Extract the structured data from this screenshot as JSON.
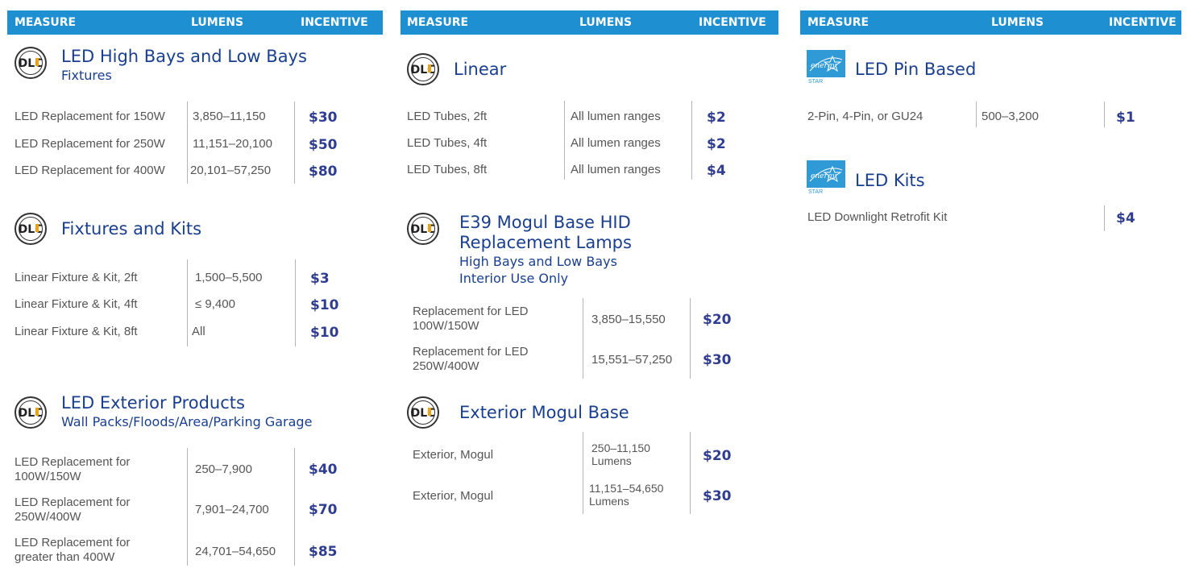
{
  "header": {
    "measure": "MEASURE",
    "lumens": "LUMENS",
    "incentive": "INCENTIVE"
  },
  "col1": {
    "s1": {
      "title": "LED High Bays and Low Bays",
      "subtitle": "Fixtures",
      "rows": [
        {
          "measure": "LED Replacement for 150W",
          "lumens": "3,850–11,150",
          "incentive": "$30"
        },
        {
          "measure": "LED Replacement for 250W",
          "lumens": "11,151–20,100",
          "incentive": "$50"
        },
        {
          "measure": "LED Replacement for 400W",
          "lumens": "20,101–57,250",
          "incentive": "$80"
        }
      ]
    },
    "s2": {
      "title": "Fixtures and Kits",
      "rows": [
        {
          "measure": "Linear Fixture & Kit, 2ft",
          "lumens": "1,500–5,500",
          "incentive": "$3"
        },
        {
          "measure": "Linear Fixture & Kit, 4ft",
          "lumens": "≤ 9,400",
          "incentive": "$10"
        },
        {
          "measure": "Linear Fixture & Kit, 8ft",
          "lumens": "All",
          "incentive": "$10"
        }
      ]
    },
    "s3": {
      "title": "LED Exterior Products",
      "subtitle": "Wall Packs/Floods/Area/Parking Garage",
      "rows": [
        {
          "measure_a": "LED Replacement for",
          "measure_b": "100W/150W",
          "lumens": "250–7,900",
          "incentive": "$40"
        },
        {
          "measure_a": "LED Replacement for",
          "measure_b": "250W/400W",
          "lumens": "7,901–24,700",
          "incentive": "$70"
        },
        {
          "measure_a": "LED Replacement for",
          "measure_b": "greater than 400W",
          "lumens": "24,701–54,650",
          "incentive": "$85"
        }
      ]
    }
  },
  "col2": {
    "s1": {
      "title": "Linear",
      "rows": [
        {
          "measure": "LED Tubes, 2ft",
          "lumens": "All lumen ranges",
          "incentive": "$2"
        },
        {
          "measure": "LED Tubes, 4ft",
          "lumens": "All lumen ranges",
          "incentive": "$2"
        },
        {
          "measure": "LED Tubes, 8ft",
          "lumens": "All lumen ranges",
          "incentive": "$4"
        }
      ]
    },
    "s2": {
      "title_a": "E39 Mogul Base HID",
      "title_b": "Replacement Lamps",
      "subtitle_a": "High Bays and Low Bays",
      "subtitle_b": "Interior Use Only",
      "rows": [
        {
          "measure_a": "Replacement for LED",
          "measure_b": "100W/150W",
          "lumens": "3,850–15,550",
          "incentive": "$20"
        },
        {
          "measure_a": "Replacement for LED",
          "measure_b": "250W/400W",
          "lumens": "15,551–57,250",
          "incentive": "$30"
        }
      ]
    },
    "s3": {
      "title": "Exterior Mogul Base",
      "rows": [
        {
          "measure": "Exterior, Mogul",
          "lumens_a": "250–11,150",
          "lumens_b": "Lumens",
          "incentive": "$20"
        },
        {
          "measure": "Exterior, Mogul",
          "lumens_a": "11,151–54,650",
          "lumens_b": "Lumens",
          "incentive": "$30"
        }
      ]
    }
  },
  "col3": {
    "s1": {
      "title": "LED Pin Based",
      "rows": [
        {
          "measure": "2-Pin, 4-Pin, or GU24",
          "lumens": "500–3,200",
          "incentive": "$1"
        }
      ]
    },
    "s2": {
      "title": "LED Kits",
      "rows": [
        {
          "measure": "LED Downlight Retrofit Kit",
          "incentive": "$4"
        }
      ]
    }
  },
  "logos": {
    "dlc_text": "DLC",
    "dlc_ring": "DLC QPL LISTED",
    "energy_star": "ENERGY STAR",
    "energy_script": "energy"
  },
  "colors": {
    "header_bg": "#1e8fd0",
    "title": "#1a3f8f",
    "incentive": "#2f3d91"
  }
}
